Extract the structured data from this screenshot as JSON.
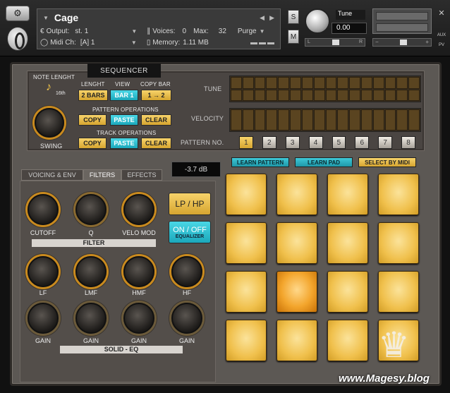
{
  "header": {
    "instrument_name": "Cage",
    "output_label": "Output:",
    "output_value": "st. 1",
    "voices_label": "Voices:",
    "voices_value": "0",
    "max_label": "Max:",
    "max_value": "32",
    "purge_label": "Purge",
    "midi_label": "Midi Ch:",
    "midi_value": "[A]  1",
    "memory_label": "Memory:",
    "memory_value": "1.11 MB",
    "solo_label": "S",
    "mute_label": "M",
    "tune_label": "Tune",
    "tune_value": "0.00",
    "pan_left": "L",
    "pan_right": "R",
    "aux_label": "AUX",
    "pv_label": "PV"
  },
  "sequencer": {
    "title": "SEQUENCER",
    "note_length_label": "NOTE LENGHT",
    "note_value": "16th",
    "swing_label": "SWING",
    "length_label": "LENGHT",
    "view_label": "VIEW",
    "copy_bar_label": "COPY BAR",
    "length_value": "2 BARS",
    "view_value": "BAR 1",
    "copy_bar_value": "1 → 2",
    "pattern_ops_label": "PATTERN OPERATIONS",
    "track_ops_label": "TRACK OPERATIONS",
    "copy": "COPY",
    "paste": "PASTE",
    "clear": "CLEAR",
    "tune_row_label": "TUNE",
    "velocity_row_label": "VELOCITY",
    "pattern_no_label": "PATTERN NO.",
    "patterns": [
      "1",
      "2",
      "3",
      "4",
      "5",
      "6",
      "7",
      "8"
    ],
    "active_pattern": "1"
  },
  "tabs": [
    "VOICING & ENV",
    "FILTERS",
    "EFFECTS"
  ],
  "selected_tab": "FILTERS",
  "db_readout": "-3.7 dB",
  "filter": {
    "knobs": [
      "CUTOFF",
      "Q",
      "VELO MOD"
    ],
    "section_label": "FILTER",
    "lp_hp_label": "LP / HP",
    "on_off_label": "ON / OFF",
    "equalizer_label": "EQUALIZER"
  },
  "eq": {
    "bands": [
      "LF",
      "LMF",
      "HMF",
      "HF"
    ],
    "gain_label": "GAIN",
    "section_label": "SOLID - EQ"
  },
  "pads": {
    "learn_pattern": "LEARN PATTERN",
    "learn_pad": "LEARN PAD",
    "select_by_midi": "SELECT BY MIDI",
    "hit_pad_index": 9
  },
  "watermark": "www.Magesy.blog",
  "colors": {
    "accent_yellow": "#f2c54a",
    "accent_cyan": "#2bc3d4",
    "knob_ring": "#c98a1e",
    "panel": "#5c5854"
  }
}
